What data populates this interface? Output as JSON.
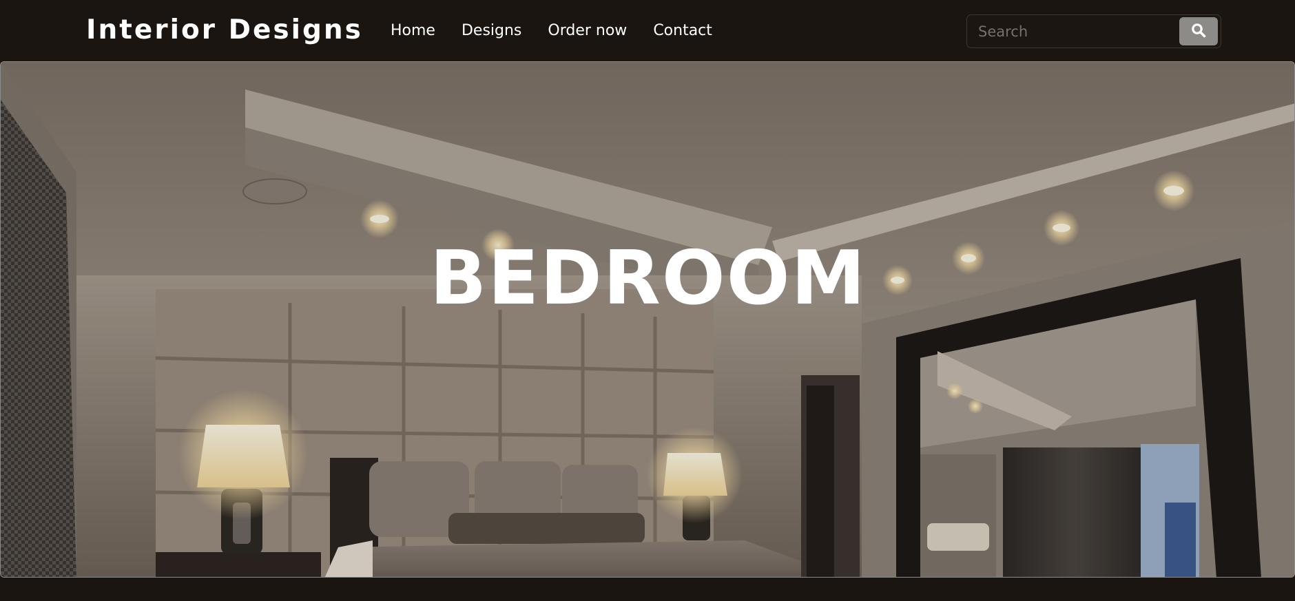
{
  "navbar": {
    "brand": "Interior Designs",
    "links": [
      {
        "label": "Home"
      },
      {
        "label": "Designs"
      },
      {
        "label": "Order now"
      },
      {
        "label": "Contact"
      }
    ],
    "search": {
      "placeholder": "Search",
      "value": "",
      "button_icon": "search-icon"
    }
  },
  "hero": {
    "title": "BEDROOM",
    "image": "bedroom-photo"
  },
  "colors": {
    "nav_background": "#1a1510",
    "text": "#ffffff",
    "search_button": "#8d8b88"
  }
}
